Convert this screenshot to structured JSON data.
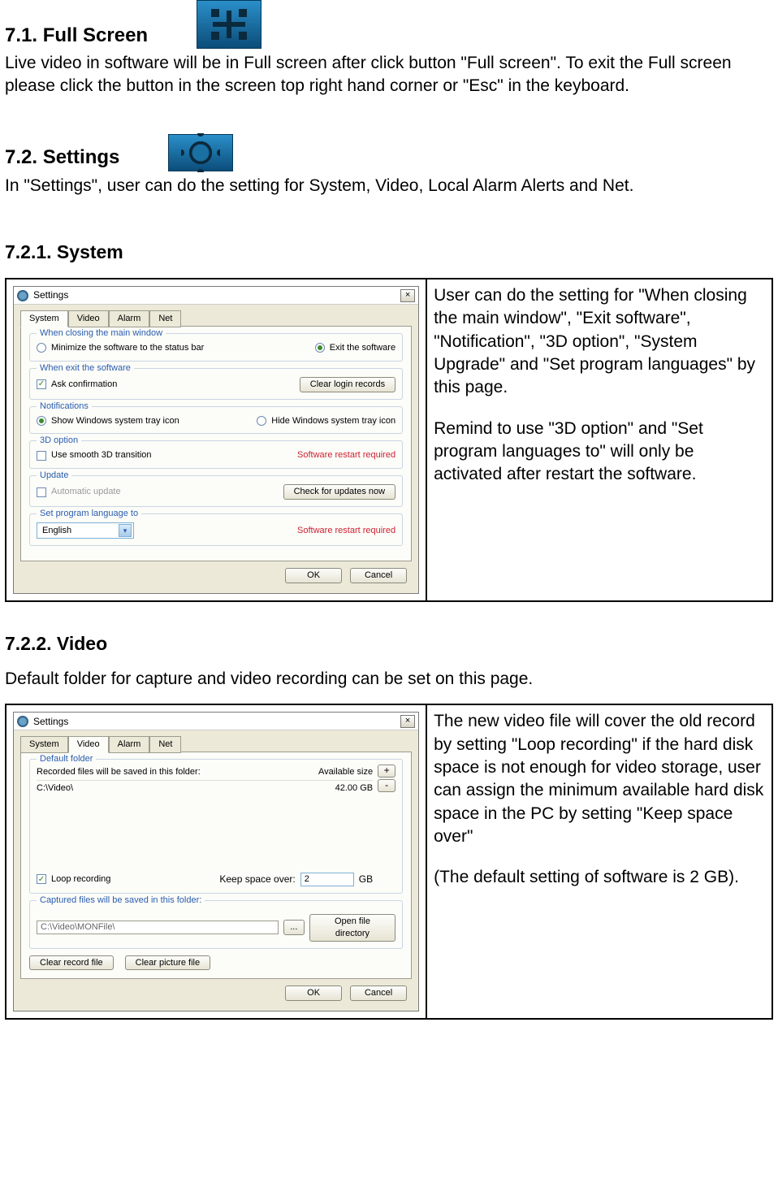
{
  "sections": {
    "s71": {
      "heading": "7.1. Full Screen",
      "body": "Live video in software will be in Full screen after click button \"Full screen\". To exit the Full screen please click the button in the screen top right hand corner or \"Esc\" in the keyboard."
    },
    "s72": {
      "heading": "7.2. Settings",
      "body": "In \"Settings\", user can do the setting for System, Video, Local Alarm Alerts and Net."
    },
    "s721": {
      "heading": "7.2.1.  System",
      "desc1": "User can do the setting for \"When closing the main window\", \"Exit software\", \"Notification\", \"3D option\", \"System Upgrade\" and \"Set program languages\" by this page.",
      "desc2": "Remind to use \"3D option\" and \"Set program languages to\" will only be activated after restart the software."
    },
    "s722": {
      "heading": "7.2.2.  Video",
      "intro": "Default folder for capture and video recording can be set on this page.",
      "desc1": "The new video file will cover the old record by setting \"Loop recording\" if the hard disk space is not enough for video storage, user can assign the minimum available hard disk space in the PC by setting \"Keep space over\"",
      "desc2": "(The default setting of software is 2 GB)."
    }
  },
  "dialog1": {
    "title": "Settings",
    "tabs": [
      "System",
      "Video",
      "Alarm",
      "Net"
    ],
    "grp1": {
      "title": "When closing the main window",
      "opt1": "Minimize the software to the status bar",
      "opt2": "Exit the software"
    },
    "grp2": {
      "title": "When exit the software",
      "chk": "Ask confirmation",
      "btn": "Clear login records"
    },
    "grp3": {
      "title": "Notifications",
      "opt1": "Show Windows system tray icon",
      "opt2": "Hide Windows system tray icon"
    },
    "grp4": {
      "title": "3D option",
      "chk": "Use smooth 3D transition",
      "warn": "Software restart required"
    },
    "grp5": {
      "title": "Update",
      "chk": "Automatic update",
      "btn": "Check for updates now"
    },
    "grp6": {
      "title": "Set program language to",
      "value": "English",
      "warn": "Software restart required"
    },
    "ok": "OK",
    "cancel": "Cancel"
  },
  "dialog2": {
    "title": "Settings",
    "tabs": [
      "System",
      "Video",
      "Alarm",
      "Net"
    ],
    "grp1": {
      "title": "Default folder",
      "hdr1": "Recorded files will be saved in this folder:",
      "hdr2": "Available size",
      "path": "C:\\Video\\",
      "size": "42.00 GB"
    },
    "loop_label": "Loop recording",
    "keep_label": "Keep space over:",
    "keep_value": "2",
    "keep_unit": "GB",
    "cap_label": "Captured files will be saved in this folder:",
    "cap_path": "C:\\Video\\MONFile\\",
    "browse": "...",
    "open": "Open file directory",
    "clear_rec": "Clear record file",
    "clear_pic": "Clear picture file",
    "ok": "OK",
    "cancel": "Cancel"
  }
}
